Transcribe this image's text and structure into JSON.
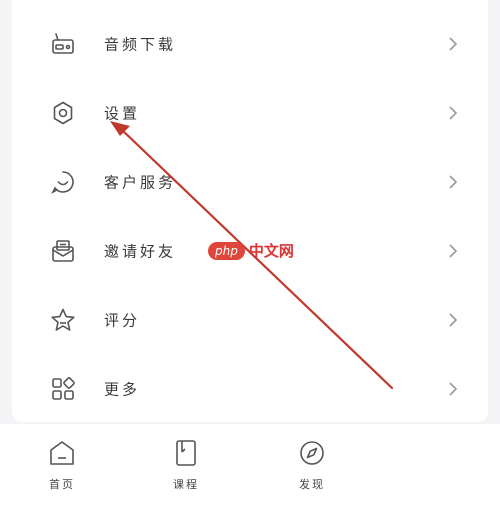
{
  "menu": {
    "items": [
      {
        "label": "音频下载",
        "icon": "radio-icon"
      },
      {
        "label": "设置",
        "icon": "gear-icon"
      },
      {
        "label": "客户服务",
        "icon": "chat-icon"
      },
      {
        "label": "邀请好友",
        "icon": "mail-icon"
      },
      {
        "label": "评分",
        "icon": "star-icon"
      },
      {
        "label": "更多",
        "icon": "grid-icon"
      }
    ]
  },
  "tabbar": {
    "tabs": [
      {
        "label": "首页",
        "icon": "home-icon"
      },
      {
        "label": "课程",
        "icon": "book-icon"
      },
      {
        "label": "发现",
        "icon": "compass-icon"
      }
    ]
  },
  "watermark": {
    "badge": "php",
    "text": "中文网"
  },
  "colors": {
    "arrow": "#c0392b",
    "icon_stroke": "#555555",
    "background": "#f4f4f6"
  }
}
